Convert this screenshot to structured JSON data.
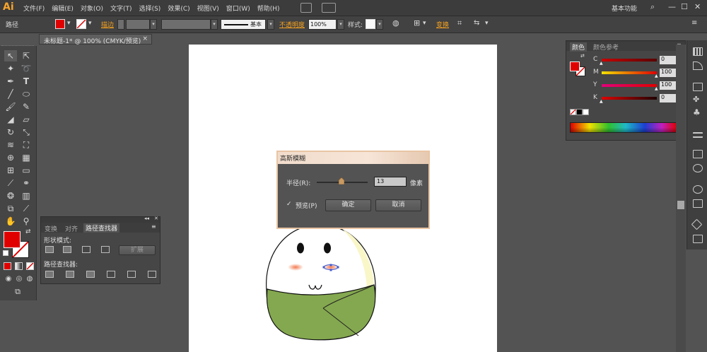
{
  "app": {
    "logo": "Ai",
    "workspace": "基本功能"
  },
  "menu": [
    "文件(F)",
    "编辑(E)",
    "对象(O)",
    "文字(T)",
    "选择(S)",
    "效果(C)",
    "视图(V)",
    "窗口(W)",
    "帮助(H)"
  ],
  "window_controls": {
    "minimize": "—",
    "maximize": "☐",
    "close": "✕"
  },
  "control": {
    "selection": "路径",
    "stroke_label": "描边",
    "stroke_style": "基本",
    "opacity_label": "不透明度",
    "opacity_value": "100%",
    "style_label": "样式:",
    "transform_label": "变换",
    "fill_color": "#e00000"
  },
  "document": {
    "tab_title": "未标题-1* @ 100% (CMYK/预览)",
    "close": "×"
  },
  "dialog": {
    "title": "高斯模糊",
    "radius_label": "半径(R):",
    "radius_value": "13",
    "radius_unit": "像素",
    "slider_fraction": 0.48,
    "preview_check": "✓",
    "preview_label": "预览(P)",
    "ok": "确定",
    "cancel": "取消"
  },
  "pathfinder_panel": {
    "tabs": [
      "变换",
      "对齐",
      "路径查找器"
    ],
    "shape_modes_label": "形状模式:",
    "expand_label": "扩展",
    "pathfinders_label": "路径查找器:"
  },
  "color_panel": {
    "tabs": [
      "颜色",
      "颜色参考"
    ],
    "channels": [
      {
        "name": "C",
        "value": "0",
        "unit": "%",
        "fraction": 0.0
      },
      {
        "name": "M",
        "value": "100",
        "unit": "%",
        "fraction": 1.0
      },
      {
        "name": "Y",
        "value": "100",
        "unit": "%",
        "fraction": 1.0
      },
      {
        "name": "K",
        "value": "0",
        "unit": "%",
        "fraction": 0.0
      }
    ]
  },
  "colors": {
    "accent": "#f4a11f",
    "fill": "#e00000",
    "rice_leaf": "#84a84f"
  }
}
